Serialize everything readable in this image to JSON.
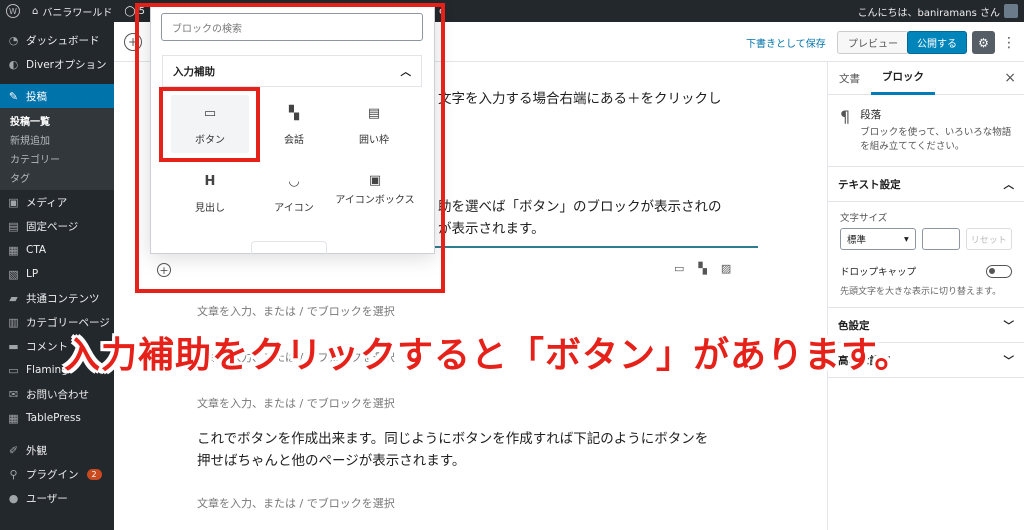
{
  "adminbar": {
    "site_name": "バニラワールド",
    "comment_count": "5",
    "trailing": "e",
    "greeting": "こんにちは、baniramans さん"
  },
  "sidebar": {
    "items": [
      {
        "label": "ダッシュボード",
        "icon": "dashboard-icon"
      },
      {
        "label": "Diverオプション",
        "icon": "diver-icon"
      },
      {
        "label": "投稿",
        "icon": "pin-icon"
      },
      {
        "label": "メディア",
        "icon": "media-icon"
      },
      {
        "label": "固定ページ",
        "icon": "page-icon"
      },
      {
        "label": "CTA",
        "icon": "cta-icon"
      },
      {
        "label": "LP",
        "icon": "lp-icon"
      },
      {
        "label": "共通コンテンツ",
        "icon": "folder-icon"
      },
      {
        "label": "カテゴリーページ",
        "icon": "category-page-icon"
      },
      {
        "label": "コメント",
        "icon": "comment-icon"
      },
      {
        "label": "Flamingo",
        "icon": "flamingo-icon"
      },
      {
        "label": "お問い合わせ",
        "icon": "mail-icon"
      },
      {
        "label": "TablePress",
        "icon": "table-icon"
      },
      {
        "label": "外観",
        "icon": "brush-icon"
      },
      {
        "label": "プラグイン",
        "icon": "plugin-icon"
      },
      {
        "label": "ユーザー",
        "icon": "user-icon"
      }
    ],
    "submenu": [
      "投稿一覧",
      "新規追加",
      "カテゴリー",
      "タグ"
    ],
    "plugin_badge": "2"
  },
  "header": {
    "save_draft": "下書きとして保存",
    "preview": "プレビュー",
    "publish": "公開する"
  },
  "inserter": {
    "search_placeholder": "ブロックの検索",
    "panel_title": "入力補助",
    "blocks": [
      {
        "label": "ボタン",
        "icon": "button-icon"
      },
      {
        "label": "会話",
        "icon": "chat-icon"
      },
      {
        "label": "囲い枠",
        "icon": "frame-icon"
      },
      {
        "label": "見出し",
        "icon": "heading-icon"
      },
      {
        "label": "アイコン",
        "icon": "smile-icon"
      },
      {
        "label": "アイコンボックス",
        "icon": "iconbox-icon"
      }
    ]
  },
  "canvas": {
    "para1": "文字を入力する場合右端にある＋をクリックし",
    "para2_line1": "助を選べば「ボタン」のブロックが表示されの",
    "para2_line2": "が表示されます。",
    "placeholder": "文章を入力、または / でブロックを選択",
    "para3_line1": "これでボタンを作成出来ます。同じようにボタンを作成すれば下記のようにボタンを",
    "para3_line2": "押せばちゃんと他のページが表示されます。"
  },
  "settings": {
    "tab_document": "文書",
    "tab_block": "ブロック",
    "block_name": "段落",
    "block_desc": "ブロックを使って、いろいろな物語を組み立ててください。",
    "text_settings": "テキスト設定",
    "font_size_label": "文字サイズ",
    "font_size_value": "標準",
    "reset": "リセット",
    "drop_cap": "ドロップキャップ",
    "drop_cap_help": "先頭文字を大きな表示に切り替えます。",
    "color_settings": "色設定",
    "advanced": "高度な設定"
  },
  "caption": "入力補助をクリックすると「ボタン」があります。",
  "colors": {
    "annotation_red": "#e52119",
    "wp_blue": "#0073aa",
    "admin_dark": "#23282d"
  }
}
